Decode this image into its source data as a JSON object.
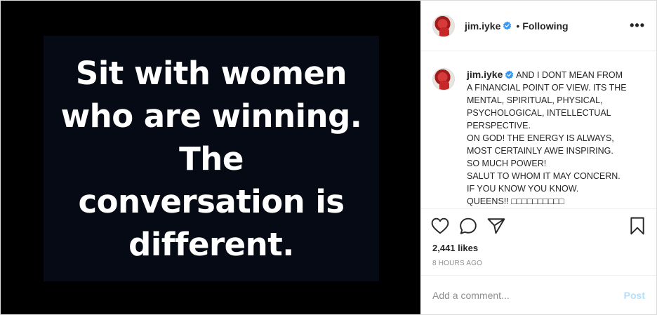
{
  "media": {
    "lines": [
      "Sit with women",
      "who are winning.",
      "The",
      "conversation is",
      "different."
    ]
  },
  "header": {
    "username": "jim.iyke",
    "separator": "•",
    "following_label": "Following",
    "more_label": "•••"
  },
  "caption": {
    "username": "jim.iyke",
    "lines": [
      "AND I DONT MEAN FROM",
      "A FINANCIAL POINT OF VIEW. ITS THE",
      "MENTAL, SPIRITUAL, PHYSICAL,",
      "PSYCHOLOGICAL, INTELLECTUAL",
      "PERSPECTIVE.",
      "ON GOD! THE ENERGY IS ALWAYS,",
      "MOST CERTAINLY AWE INSPIRING.",
      "SO MUCH POWER!",
      "SALUT TO WHOM IT MAY CONCERN.",
      "IF YOU KNOW YOU KNOW.",
      "QUEENS!! □□□□□□□□□□"
    ]
  },
  "stats": {
    "likes": "2,441 likes",
    "time": "8 HOURS AGO"
  },
  "comment": {
    "placeholder": "Add a comment...",
    "post_label": "Post"
  },
  "icons": {
    "like": "heart-icon",
    "comment": "comment-bubble-icon",
    "share": "paper-plane-icon",
    "save": "bookmark-icon",
    "verified": "verified-badge-icon"
  },
  "colors": {
    "verified": "#3897f0",
    "post_button": "#b2dffc",
    "muted_text": "#8e8e8e",
    "primary_text": "#262626"
  }
}
